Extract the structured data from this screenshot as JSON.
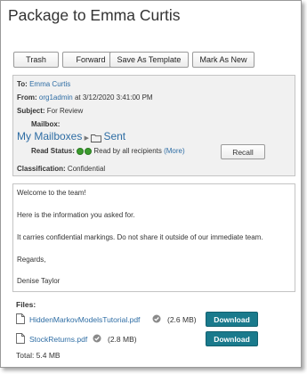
{
  "title": "Package to Emma Curtis",
  "toolbar": {
    "trash": "Trash",
    "forward": "Forward",
    "save_template": "Save As Template",
    "mark_new": "Mark As New"
  },
  "header": {
    "to_label": "To:",
    "to_value": "Emma Curtis",
    "from_label": "From:",
    "from_user": "org1admin",
    "from_date": "at 3/12/2020 3:41:00 PM",
    "subject_label": "Subject:",
    "subject_value": "For Review",
    "mailbox_label": "Mailbox:",
    "mailbox_root": "My Mailboxes",
    "mailbox_separator": "▶",
    "mailbox_folder": "Sent",
    "read_status_label": "Read Status:",
    "read_status_value": "Read by all recipients",
    "more_link": "(More)",
    "recall": "Recall",
    "classification_label": "Classification:",
    "classification_value": "Confidential"
  },
  "body_lines": [
    "Welcome to the team!",
    "Here is the information you asked for.",
    "It carries confidential markings. Do not share it outside of our immediate team.",
    "Regards,",
    "Denise Taylor"
  ],
  "files": {
    "label": "Files:",
    "items": [
      {
        "name": "HiddenMarkovModelsTutorial.pdf",
        "size": "(2.6 MB)",
        "action": "Download"
      },
      {
        "name": "StockReturns.pdf",
        "size": "(2.8 MB)",
        "action": "Download"
      }
    ],
    "total": "Total: 5.4 MB"
  }
}
